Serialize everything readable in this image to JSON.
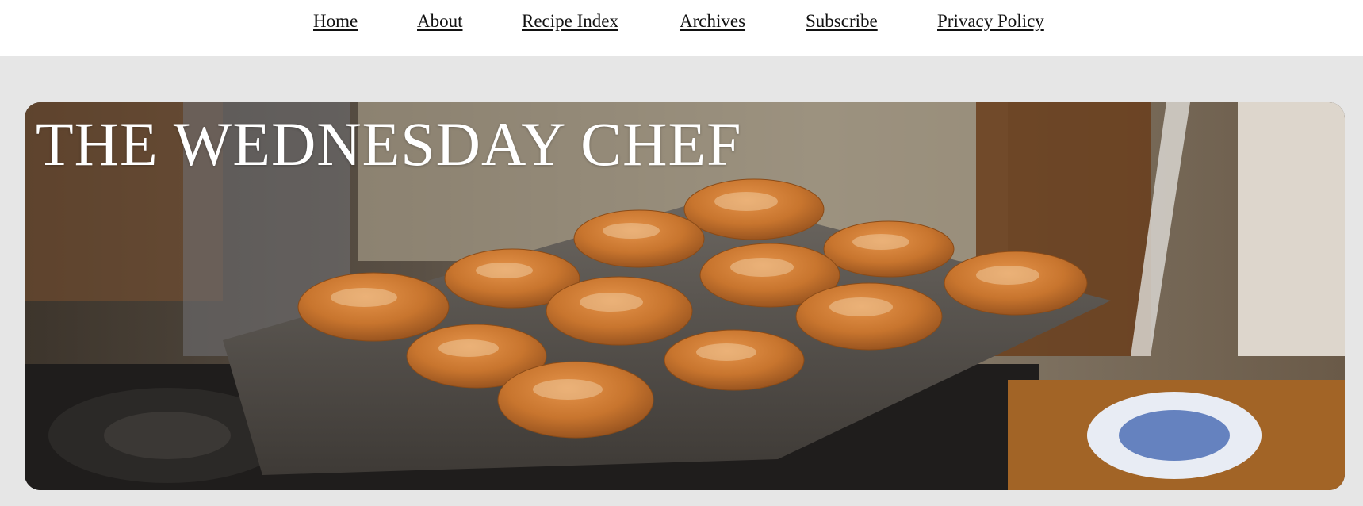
{
  "nav": {
    "items": [
      {
        "label": "Home"
      },
      {
        "label": "About"
      },
      {
        "label": "Recipe Index"
      },
      {
        "label": "Archives"
      },
      {
        "label": "Subscribe"
      },
      {
        "label": "Privacy Policy"
      }
    ]
  },
  "header": {
    "site_title": "THE WEDNESDAY CHEF",
    "photo_subject": "muffin-tin-with-sugar-topped-muffins-on-stovetop"
  },
  "colors": {
    "page_background": "#e6e6e6",
    "nav_background": "#ffffff",
    "title_text": "#ffffff",
    "muffin": "#c8752e"
  }
}
